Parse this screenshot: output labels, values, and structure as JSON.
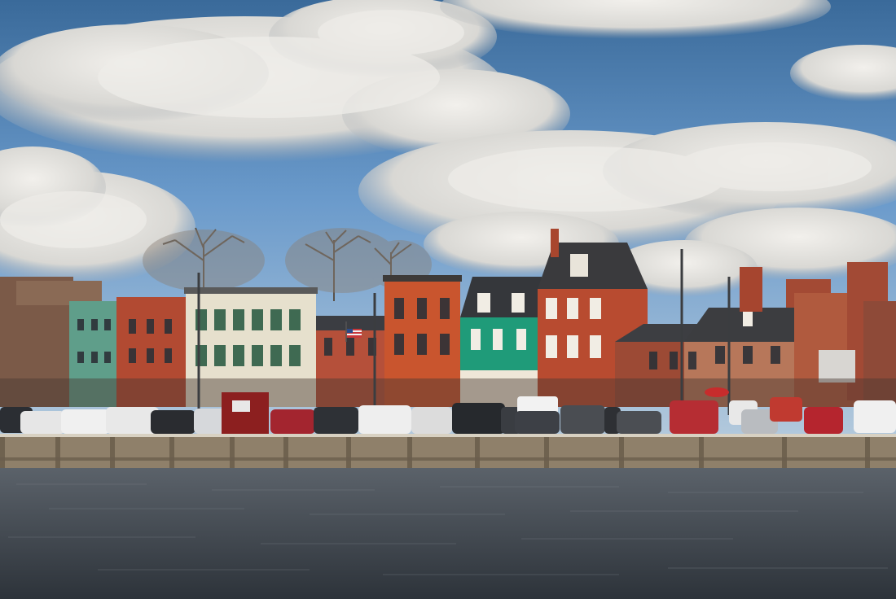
{
  "scene": {
    "description_text": "",
    "colors": {
      "sky_top": "#3f6f9e",
      "sky_mid": "#6f9fcf",
      "sky_low": "#a9c3d9",
      "cloud": "#e8e6e1",
      "cloud_shade": "#9ea3a8",
      "water_top": "#5a6068",
      "water_bottom": "#2e343b",
      "pier": "#8f7f66",
      "brick_red": "#b24a30",
      "brick_orange": "#c8552f",
      "teal": "#1f9a7a",
      "mint": "#5c9c86",
      "cream": "#e8e2cf",
      "slate_roof": "#3a3a3d",
      "tan_brick": "#b8775a",
      "booth": "#8c1f1f"
    }
  }
}
